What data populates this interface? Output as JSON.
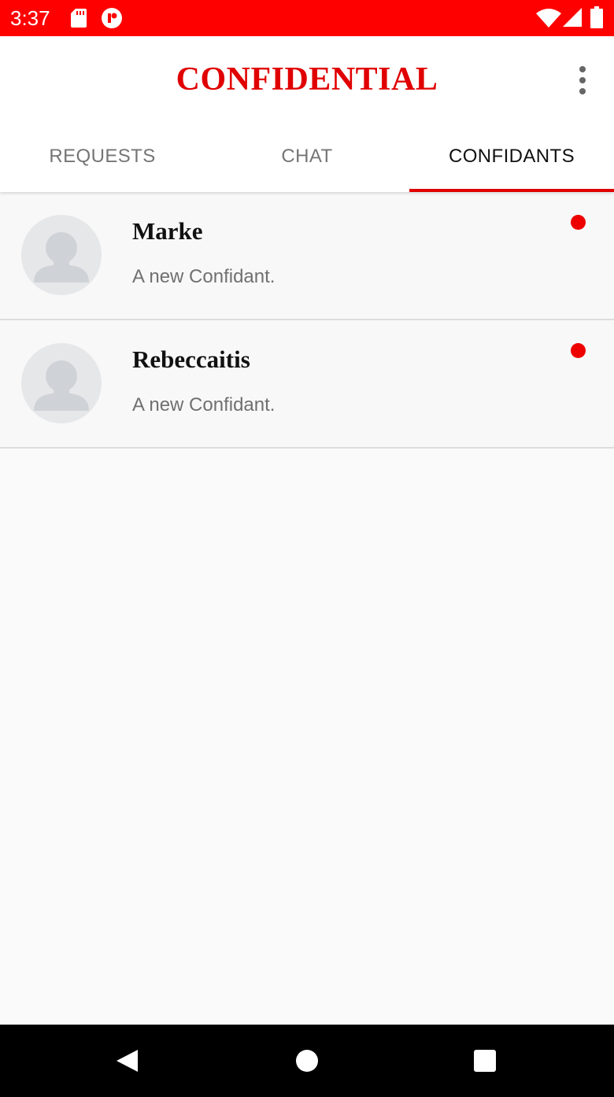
{
  "status_bar": {
    "time": "3:37",
    "icons": [
      "sd-card-icon",
      "notification-app-icon",
      "wifi-icon",
      "cellular-signal-icon",
      "battery-icon"
    ],
    "background": "#ff0000"
  },
  "app_bar": {
    "title": "CONFIDENTIAL",
    "title_color": "#e00000",
    "menu_icon": "more-vert-icon"
  },
  "tabs": [
    {
      "label": "REQUESTS",
      "active": false
    },
    {
      "label": "CHAT",
      "active": false
    },
    {
      "label": "CONFIDANTS",
      "active": true
    }
  ],
  "tab_colors": {
    "active_text": "#111111",
    "inactive_text": "#757575",
    "indicator": "#e00000"
  },
  "confidants": [
    {
      "name": "Marke",
      "subtitle": "A new Confidant.",
      "avatar_icon": "default-avatar-icon",
      "online": true
    },
    {
      "name": "Rebeccaitis",
      "subtitle": "A new Confidant.",
      "avatar_icon": "default-avatar-icon",
      "online": true
    }
  ],
  "online_dot_color": "#ee0000",
  "nav_bar": {
    "buttons": [
      "back-icon",
      "home-icon",
      "recents-icon"
    ]
  }
}
